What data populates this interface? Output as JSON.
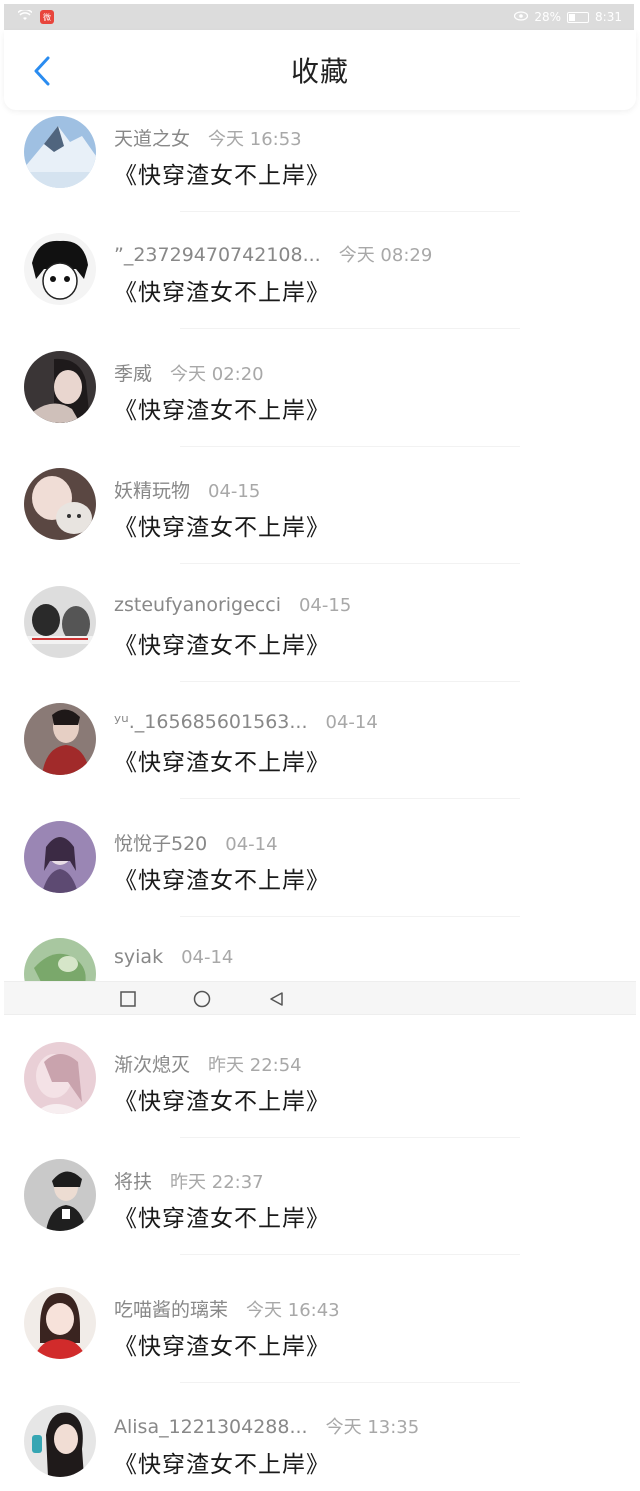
{
  "status_bar": {
    "battery_text": "28%",
    "time": "8:31",
    "app_badge": "微",
    "wifi_icon": "wifi-icon",
    "eye_icon": "eye-icon"
  },
  "header": {
    "title": "收藏",
    "back_icon": "chevron-left-icon",
    "accent_color": "#2a8cf0"
  },
  "items": [
    {
      "name": "天道之女",
      "time": "今天 16:53",
      "book": "《快穿渣女不上岸》"
    },
    {
      "name": "”_23729470742108...",
      "time": "今天 08:29",
      "book": "《快穿渣女不上岸》"
    },
    {
      "name": "季威",
      "time": "今天 02:20",
      "book": "《快穿渣女不上岸》"
    },
    {
      "name": "妖精玩物",
      "time": "04-15",
      "book": "《快穿渣女不上岸》"
    },
    {
      "name": "zsteufyanorigecci",
      "time": "04-15",
      "book": "《快穿渣女不上岸》"
    },
    {
      "name": "ʸᵘ._165685601563...",
      "time": "04-14",
      "book": "《快穿渣女不上岸》"
    },
    {
      "name": "悅悅子520",
      "time": "04-14",
      "book": "《快穿渣女不上岸》"
    },
    {
      "name": "syiak",
      "time": "04-14",
      "book": ""
    },
    {
      "name": "渐次熄灭",
      "time": "昨天 22:54",
      "book": "《快穿渣女不上岸》"
    },
    {
      "name": "将扶",
      "time": "昨天 22:37",
      "book": "《快穿渣女不上岸》"
    },
    {
      "name": "吃喵酱的璃茉",
      "time": "今天 16:43",
      "book": "《快穿渣女不上岸》"
    },
    {
      "name": "Alisa_1221304288...",
      "time": "今天 13:35",
      "book": "《快穿渣女不上岸》"
    }
  ],
  "nav_bar": {
    "recent_icon": "square-icon",
    "home_icon": "circle-icon",
    "back_icon": "triangle-back-icon"
  }
}
